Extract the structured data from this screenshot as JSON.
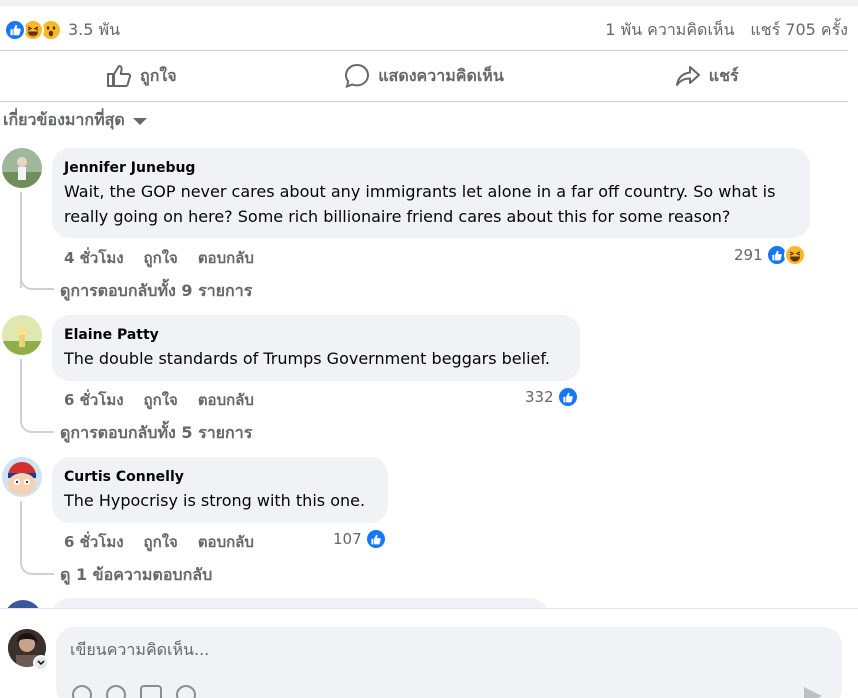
{
  "summary": {
    "reactions_count": "3.5 พัน",
    "comments": "1 พัน ความคิดเห็น",
    "shares": "แชร์ 705 ครั้ง",
    "reaction_icons": [
      "like-icon",
      "haha-icon",
      "wow-icon"
    ]
  },
  "actions": {
    "like": "ถูกใจ",
    "comment": "แสดงความคิดเห็น",
    "share": "แชร์"
  },
  "sort": {
    "label": "เกี่ยวข้องมากที่สุด"
  },
  "comments": [
    {
      "author": "Jennifer Junebug",
      "text": "Wait, the GOP never cares about any immigrants let alone in a far off country. So what is really going on here? Some rich billionaire friend cares about this for some reason?",
      "time": "4 ชั่วโมง",
      "like": "ถูกใจ",
      "reply": "ตอบกลับ",
      "reactions": "291",
      "view_replies": "ดูการตอบกลับทั้ง 9 รายการ"
    },
    {
      "author": "Elaine Patty",
      "text": "The double standards of Trumps Government beggars belief.",
      "time": "6 ชั่วโมง",
      "like": "ถูกใจ",
      "reply": "ตอบกลับ",
      "reactions": "332",
      "view_replies": "ดูการตอบกลับทั้ง 5 รายการ"
    },
    {
      "author": "Curtis Connelly",
      "text": "The Hypocrisy is strong with this one.",
      "time": "6 ชั่วโมง",
      "like": "ถูกใจ",
      "reply": "ตอบกลับ",
      "reactions": "107",
      "view_replies": "ดู 1 ข้อความตอบกลับ"
    }
  ],
  "composer": {
    "placeholder": "เขียนความคิดเห็น..."
  },
  "colors": {
    "accent": "#1877f2",
    "secondary_text": "#65676b",
    "bubble": "#f0f2f5",
    "haha": "#f7b928"
  }
}
